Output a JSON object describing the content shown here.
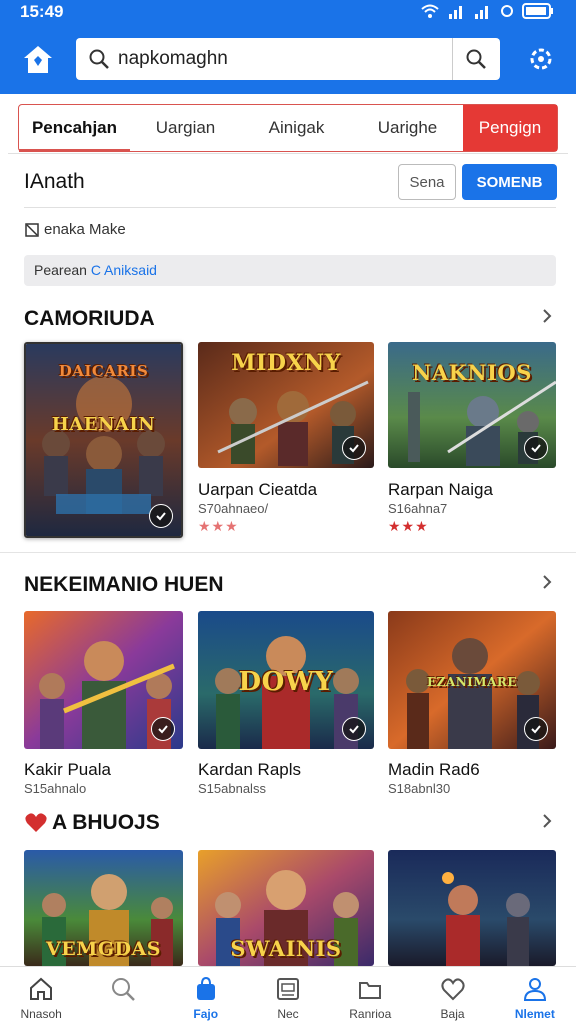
{
  "status": {
    "time": "15:49"
  },
  "header": {
    "search_value": "napkomaghn"
  },
  "tabs": [
    {
      "label": "Pencahjan",
      "active": true
    },
    {
      "label": "Uargian",
      "active": false
    },
    {
      "label": "Ainigak",
      "active": false
    },
    {
      "label": "Uarighe",
      "active": false
    },
    {
      "label": "Pengign",
      "active": false
    }
  ],
  "account": {
    "name": "IAnath",
    "secondary_button": "Sena",
    "primary_button": "SOMENB",
    "info": "enaka Make",
    "banner_prefix": "Pearean ",
    "banner_accent": "C Aniksaid"
  },
  "sections": [
    {
      "title": "CAMORIUDA",
      "cards": [
        {
          "art_title": "HAENAIN",
          "art_top": "DAICARIS",
          "title": "",
          "sub": "",
          "stars": ""
        },
        {
          "art_title": "MIDXNY",
          "art_top": "",
          "title": "Uarpan Cieatda",
          "sub": "S70ahnaeo/",
          "stars": "★★★"
        },
        {
          "art_title": "NAKNIOS",
          "art_top": "",
          "title": "Rarpan Naiga",
          "sub": "S16ahna7",
          "stars": "★★★"
        }
      ]
    },
    {
      "title": "NEKEIMANIO HUEN",
      "cards": [
        {
          "art_title": "",
          "art_top": "",
          "title": "Kakir Puala",
          "sub": "S15ahnalo",
          "stars": ""
        },
        {
          "art_title": "DOWY",
          "art_top": "",
          "title": "Kardan Rapls",
          "sub": "S15abnalss",
          "stars": ""
        },
        {
          "art_title": "EZANIMARE",
          "art_top": "",
          "title": "Madin Rad6",
          "sub": "S18abnl30",
          "stars": ""
        }
      ]
    },
    {
      "title": "A BHUOJS",
      "cards": [
        {
          "art_title": "VEMGDAS",
          "art_top": "",
          "title": "",
          "sub": "",
          "stars": ""
        },
        {
          "art_title": "SWAINIS",
          "art_top": "",
          "title": "",
          "sub": "",
          "stars": ""
        },
        {
          "art_title": "",
          "art_top": "",
          "title": "",
          "sub": "",
          "stars": ""
        }
      ]
    }
  ],
  "bottom_nav": [
    {
      "label": "Nnasoh",
      "icon": "home-icon",
      "active": false
    },
    {
      "label": "",
      "icon": "search-icon",
      "active": false
    },
    {
      "label": "Fajo",
      "icon": "bag-icon",
      "active": true
    },
    {
      "label": "Nec",
      "icon": "document-icon",
      "active": false
    },
    {
      "label": "Ranrioa",
      "icon": "folder-icon",
      "active": false
    },
    {
      "label": "Baja",
      "icon": "heart-icon",
      "active": false
    },
    {
      "label": "Nlemet",
      "icon": "profile-icon",
      "active": true
    }
  ],
  "colors": {
    "primary": "#1a73e8",
    "accent_red": "#e53935",
    "star_red": "#d32f2f"
  }
}
